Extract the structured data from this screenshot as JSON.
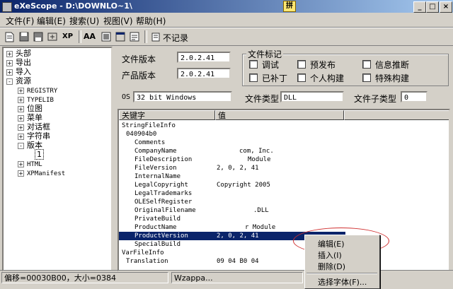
{
  "window": {
    "title": "eXeScope - D:\\DOWNLO~1\\",
    "ime_char": "拼",
    "controls": [
      "_",
      "□",
      "×"
    ]
  },
  "menu": [
    {
      "label": "文件(F)"
    },
    {
      "label": "编辑(E)"
    },
    {
      "label": "搜索(U)"
    },
    {
      "label": "视图(V)"
    },
    {
      "label": "帮助(H)"
    }
  ],
  "toolbar": {
    "xp_label": "XP",
    "aa_label": "AA",
    "no_record_label": "不记录"
  },
  "tree": {
    "items": [
      {
        "label": "头部",
        "box": "+"
      },
      {
        "label": "导出",
        "box": "+"
      },
      {
        "label": "导入",
        "box": "+"
      },
      {
        "label": "资源",
        "box": "-"
      },
      {
        "label": "REGISTRY",
        "box": "+"
      },
      {
        "label": "TYPELIB",
        "box": "+"
      },
      {
        "label": "位图",
        "box": "+"
      },
      {
        "label": "菜单",
        "box": "+"
      },
      {
        "label": "对话框",
        "box": "+"
      },
      {
        "label": "字符串",
        "box": "+"
      },
      {
        "label": "版本",
        "box": "-"
      },
      {
        "label": "1",
        "box": ""
      },
      {
        "label": "HTML",
        "box": "+"
      },
      {
        "label": "XPManifest",
        "box": "+"
      }
    ]
  },
  "version_form": {
    "file_version_label": "文件版本",
    "file_version_value": "2.0.2.41",
    "product_version_label": "产品版本",
    "product_version_value": "2.0.2.41",
    "flags_group_label": "文件标记",
    "flags": [
      {
        "label": "调试",
        "checked": false
      },
      {
        "label": "预发布",
        "checked": false
      },
      {
        "label": "信息推断",
        "checked": false
      },
      {
        "label": "已补丁",
        "checked": false
      },
      {
        "label": "个人构建",
        "checked": false
      },
      {
        "label": "特殊构建",
        "checked": false
      }
    ],
    "os_label": "OS",
    "os_value": "32 bit Windows",
    "file_type_label": "文件类型",
    "file_type_value": "DLL",
    "file_subtype_label": "文件子类型",
    "file_subtype_value": "0"
  },
  "list": {
    "columns": [
      "关键字",
      "值"
    ],
    "rows": [
      {
        "key": "StringFileInfo",
        "value": ""
      },
      {
        "key": "040904b0",
        "value": ""
      },
      {
        "key": "Comments",
        "value": ""
      },
      {
        "key": "CompanyName",
        "value": "com, Inc."
      },
      {
        "key": "FileDescription",
        "value": "Module"
      },
      {
        "key": "FileVersion",
        "value": "2, 0, 2, 41"
      },
      {
        "key": "InternalName",
        "value": ""
      },
      {
        "key": "LegalCopyright",
        "value": "Copyright 2005"
      },
      {
        "key": "LegalTrademarks",
        "value": ""
      },
      {
        "key": "OLESelfRegister",
        "value": ""
      },
      {
        "key": "OriginalFilename",
        "value": ".DLL"
      },
      {
        "key": "PrivateBuild",
        "value": ""
      },
      {
        "key": "ProductName",
        "value": "r Module"
      },
      {
        "key": "ProductVersion",
        "value": "2, 0, 2, 41",
        "selected": true
      },
      {
        "key": "SpecialBuild",
        "value": ""
      },
      {
        "key": "VarFileInfo",
        "value": ""
      },
      {
        "key": "Translation",
        "value": "09 04 B0 04"
      }
    ]
  },
  "context_menu": {
    "items": [
      "编辑(E)",
      "插入(I)",
      "删除(D)",
      "选择字体(F)..."
    ]
  },
  "status": {
    "offset_text": "偏移=00030B00，大小=0384",
    "partial_text": "Wzappa..."
  },
  "colors": {
    "annotation_ellipse": "#d03030",
    "selection": "#0a246a",
    "titlebar": "#0a246a"
  }
}
